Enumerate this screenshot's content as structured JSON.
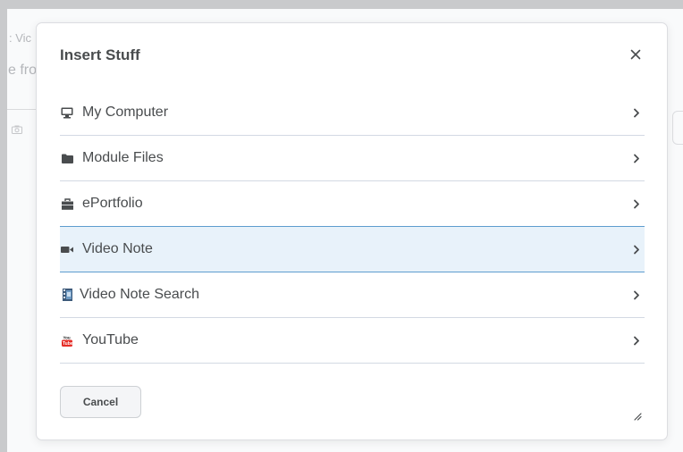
{
  "background": {
    "text_line_1": ": Vic",
    "text_line_2": "e fro"
  },
  "dialog": {
    "title": "Insert Stuff",
    "close_label": "×",
    "items": [
      {
        "label": "My Computer",
        "icon": "computer-icon",
        "selected": false
      },
      {
        "label": "Module Files",
        "icon": "folder-icon",
        "selected": false
      },
      {
        "label": "ePortfolio",
        "icon": "briefcase-icon",
        "selected": false
      },
      {
        "label": "Video Note",
        "icon": "video-camera-icon",
        "selected": true
      },
      {
        "label": "Video Note Search",
        "icon": "film-search-icon",
        "selected": false
      },
      {
        "label": "YouTube",
        "icon": "youtube-icon",
        "selected": false
      }
    ],
    "cancel_label": "Cancel"
  },
  "colors": {
    "text": "#494c4e",
    "divider": "#d3d9e3",
    "selected_bg": "#e8f2fa",
    "selected_border": "#5e9dce",
    "youtube_red": "#e52d27"
  }
}
